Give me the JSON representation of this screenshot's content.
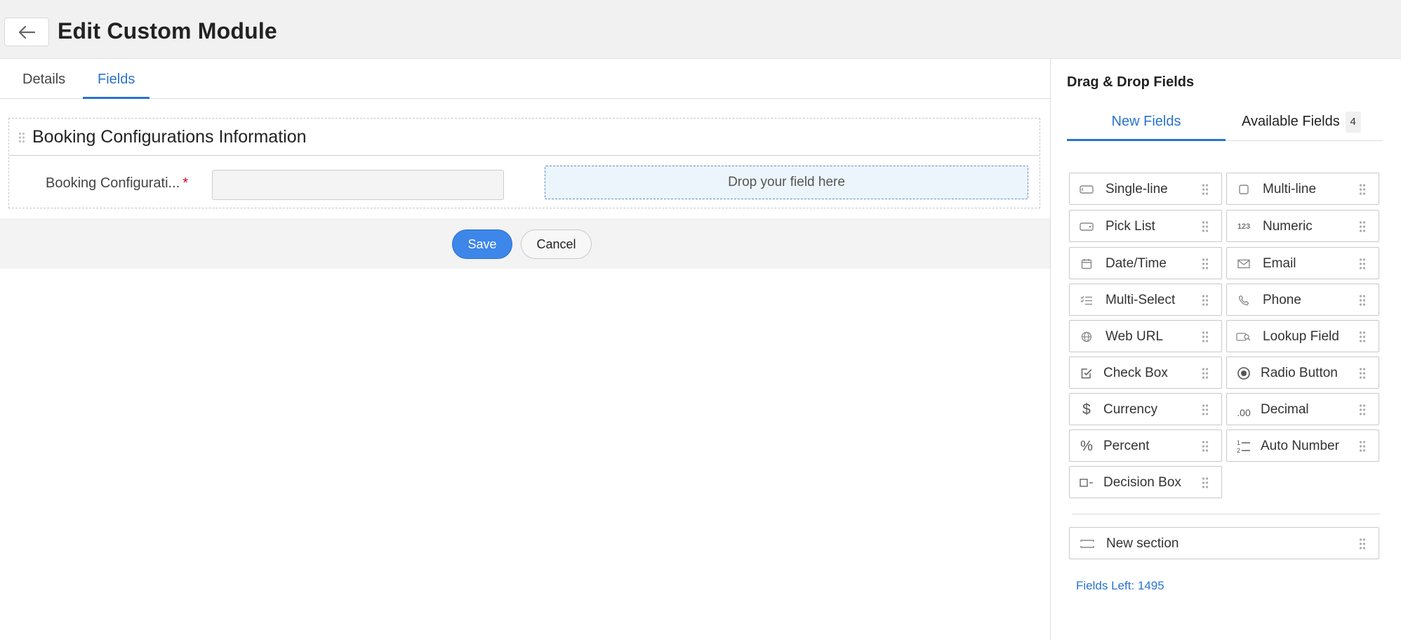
{
  "header": {
    "title": "Edit Custom Module",
    "back_icon": "arrow-left-icon"
  },
  "tabs": [
    {
      "label": "Details",
      "active": false
    },
    {
      "label": "Fields",
      "active": true
    }
  ],
  "section": {
    "title": "Booking Configurations Information",
    "field_label": "Booking Configurati...",
    "required_mark": "*",
    "field_value": "",
    "drop_text": "Drop your field here"
  },
  "actions": {
    "save": "Save",
    "cancel": "Cancel"
  },
  "panel": {
    "title": "Drag & Drop Fields",
    "tabs": [
      {
        "label": "New Fields",
        "active": true
      },
      {
        "label": "Available Fields",
        "active": false,
        "count": "4"
      }
    ],
    "fields": [
      {
        "label": "Single-line",
        "icon": "single-line-icon"
      },
      {
        "label": "Multi-line",
        "icon": "multi-line-icon"
      },
      {
        "label": "Pick List",
        "icon": "pick-list-icon"
      },
      {
        "label": "Numeric",
        "icon": "numeric-icon",
        "glyph": "123"
      },
      {
        "label": "Date/Time",
        "icon": "calendar-icon"
      },
      {
        "label": "Email",
        "icon": "envelope-icon"
      },
      {
        "label": "Multi-Select",
        "icon": "multi-select-icon"
      },
      {
        "label": "Phone",
        "icon": "phone-icon"
      },
      {
        "label": "Web URL",
        "icon": "globe-icon"
      },
      {
        "label": "Lookup Field",
        "icon": "lookup-icon"
      },
      {
        "label": "Check Box",
        "icon": "checkbox-icon"
      },
      {
        "label": "Radio Button",
        "icon": "radio-icon"
      },
      {
        "label": "Currency",
        "icon": "dollar-icon",
        "glyph": "$"
      },
      {
        "label": "Decimal",
        "icon": "decimal-icon",
        "glyph": ".00"
      },
      {
        "label": "Percent",
        "icon": "percent-icon",
        "glyph": "%"
      },
      {
        "label": "Auto Number",
        "icon": "auto-number-icon"
      },
      {
        "label": "Decision Box",
        "icon": "decision-box-icon"
      }
    ],
    "new_section": {
      "label": "New section",
      "icon": "section-icon"
    },
    "fields_left": "Fields Left: 1495"
  },
  "colors": {
    "accent": "#2a73d1",
    "save_button": "#3d86ea",
    "required": "#d0021b"
  }
}
